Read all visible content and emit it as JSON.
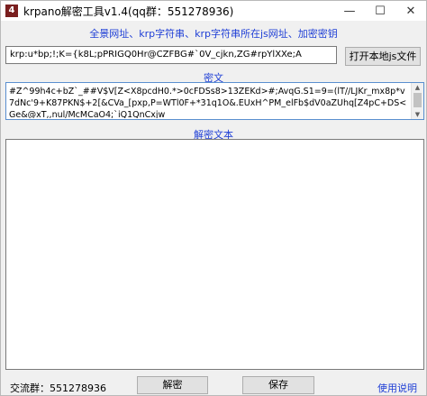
{
  "window": {
    "title": "krpano解密工具v1.4(qq群：551278936)",
    "icon": "app-logo-icon",
    "minimize_glyph": "—",
    "maximize_glyph": "☐",
    "close_glyph": "✕"
  },
  "banner": {
    "text": "全景网址、krp字符串、krp字符串所在js网址、加密密钥"
  },
  "url_input": {
    "value": "krp:u*bp;!;K={k8L;pPRIGQ0Hr@CZFBG#`0V_cjkn,ZG#rpYlXXe;A"
  },
  "buttons": {
    "open_js": "打开本地js文件",
    "decrypt": "解密",
    "save": "保存"
  },
  "cipher": {
    "label": "密文",
    "text": "#Z^99h4c+bZ`_##V$V[Z<X8pcdH0.*>0cFDSs8>13ZEKd>#;AvqG.S1=9=(lT//LJKr_mx8p*v7dNc'9+K87PKN$+2[&CVa_[pxp,P=WTl0F+*31q1O&.EUxH^PM_elFb$dV0aZUhq[Z4pC+DS<Ge&@xT,,nul/McMCaO4;`iQ1QnCxjw"
  },
  "plain": {
    "label": "解密文本",
    "text": ""
  },
  "footer": {
    "qq_group": "交流群：551278936",
    "help_link": "使用说明"
  }
}
